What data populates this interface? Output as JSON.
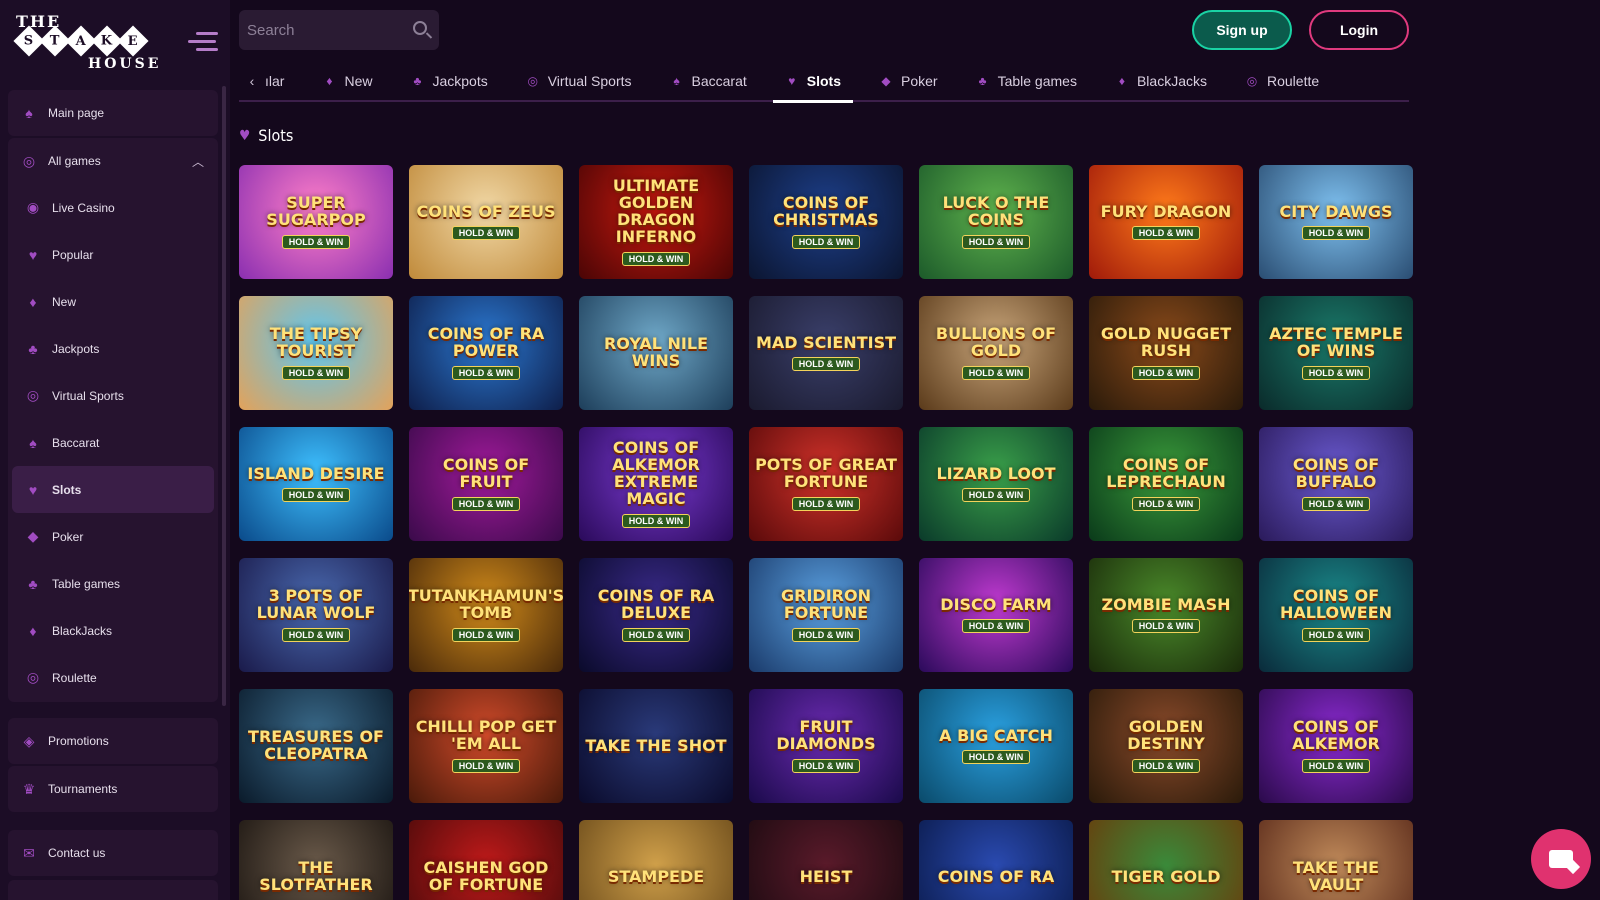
{
  "logo": {
    "row1": "THE",
    "letters": [
      "S",
      "T",
      "A",
      "K",
      "E"
    ],
    "row3": "HOUSE"
  },
  "header": {
    "search_placeholder": "Search",
    "signup_label": "Sign up",
    "login_label": "Login"
  },
  "sidebar": {
    "main_page": "Main page",
    "all_games": "All games",
    "items": [
      {
        "label": "Live Casino",
        "icon": "live-casino-icon"
      },
      {
        "label": "Popular",
        "icon": "popular-icon"
      },
      {
        "label": "New",
        "icon": "new-icon"
      },
      {
        "label": "Jackpots",
        "icon": "jackpots-icon"
      },
      {
        "label": "Virtual Sports",
        "icon": "virtual-sports-icon"
      },
      {
        "label": "Baccarat",
        "icon": "baccarat-icon"
      },
      {
        "label": "Slots",
        "icon": "slots-icon"
      },
      {
        "label": "Poker",
        "icon": "poker-icon"
      },
      {
        "label": "Table games",
        "icon": "table-games-icon"
      },
      {
        "label": "BlackJacks",
        "icon": "blackjacks-icon"
      },
      {
        "label": "Roulette",
        "icon": "roulette-icon"
      }
    ],
    "promotions": "Promotions",
    "tournaments": "Tournaments",
    "contact_us": "Contact us"
  },
  "tabs": [
    "ılar",
    "New",
    "Jackpots",
    "Virtual Sports",
    "Baccarat",
    "Slots",
    "Poker",
    "Table games",
    "BlackJacks",
    "Roulette"
  ],
  "active_tab": "Slots",
  "section_title": "Slots",
  "games": [
    {
      "name": "Super SugarPop",
      "badge": "HOLD & WIN",
      "colors": [
        "#ff7fc8",
        "#8a2fb0"
      ]
    },
    {
      "name": "Coins of Zeus",
      "badge": "HOLD & WIN",
      "colors": [
        "#f1d8a6",
        "#c08a3a"
      ]
    },
    {
      "name": "Ultimate Golden Dragon Inferno",
      "badge": "HOLD & WIN",
      "colors": [
        "#c8190f",
        "#4a0505"
      ]
    },
    {
      "name": "Coins of Christmas",
      "badge": "HOLD & WIN",
      "colors": [
        "#1d3f8a",
        "#0b1530"
      ]
    },
    {
      "name": "Luck o the Coins",
      "badge": "HOLD & WIN",
      "colors": [
        "#5fb34d",
        "#1c5a2a"
      ]
    },
    {
      "name": "Fury Dragon",
      "badge": "HOLD & WIN",
      "colors": [
        "#ff7a1a",
        "#a01a0a"
      ]
    },
    {
      "name": "City Dawgs",
      "badge": "HOLD & WIN",
      "colors": [
        "#7ec0ef",
        "#2a4d72"
      ]
    },
    {
      "name": "The Tipsy Tourist",
      "badge": "HOLD & WIN",
      "colors": [
        "#5ec6ef",
        "#e3a25a"
      ]
    },
    {
      "name": "Coins of Ra Power",
      "badge": "HOLD & WIN",
      "colors": [
        "#2b78d0",
        "#0e1e4a"
      ]
    },
    {
      "name": "Royal Nile Wins",
      "badge": "",
      "colors": [
        "#6fa8c8",
        "#1d3e5a"
      ]
    },
    {
      "name": "Mad Scientist",
      "badge": "HOLD & WIN",
      "colors": [
        "#3a3f6a",
        "#1a1a2e"
      ]
    },
    {
      "name": "Bullions of Gold",
      "badge": "HOLD & WIN",
      "colors": [
        "#c8a57a",
        "#5a3a1a"
      ]
    },
    {
      "name": "Gold Nugget Rush",
      "badge": "HOLD & WIN",
      "colors": [
        "#8a4a1a",
        "#2a1a0a"
      ]
    },
    {
      "name": "Aztec Temple of Wins",
      "badge": "HOLD & WIN",
      "colors": [
        "#1a7a6a",
        "#0a2a2a"
      ]
    },
    {
      "name": "Island Desire",
      "badge": "HOLD & WIN",
      "colors": [
        "#3ec0ff",
        "#0a4a8a"
      ]
    },
    {
      "name": "Coins of Fruit",
      "badge": "HOLD & WIN",
      "colors": [
        "#a01a9a",
        "#3a0a4a"
      ]
    },
    {
      "name": "Coins of Alkemor Extreme Magic",
      "badge": "HOLD & WIN",
      "colors": [
        "#7a3ad0",
        "#2a0a5a"
      ]
    },
    {
      "name": "Pots of Great Fortune",
      "badge": "HOLD & WIN",
      "colors": [
        "#d0322a",
        "#5a0a0a"
      ]
    },
    {
      "name": "Lizard Loot",
      "badge": "HOLD & WIN",
      "colors": [
        "#3aa04a",
        "#0a3a2a"
      ]
    },
    {
      "name": "Coins of Leprechaun",
      "badge": "HOLD & WIN",
      "colors": [
        "#3a9a3a",
        "#0a3a1a"
      ]
    },
    {
      "name": "Coins of Buffalo",
      "badge": "HOLD & WIN",
      "colors": [
        "#6a5ad0",
        "#2a1a5a"
      ]
    },
    {
      "name": "3 Pots of Lunar Wolf",
      "badge": "HOLD & WIN",
      "colors": [
        "#4a6ab0",
        "#1a1a4a"
      ]
    },
    {
      "name": "Tutankhamun's Tomb",
      "badge": "HOLD & WIN",
      "colors": [
        "#d08a1a",
        "#4a2a0a"
      ]
    },
    {
      "name": "Coins of Ra Deluxe",
      "badge": "HOLD & WIN",
      "colors": [
        "#3a2a8a",
        "#0a0a2a"
      ]
    },
    {
      "name": "Gridiron Fortune",
      "badge": "HOLD & WIN",
      "colors": [
        "#5aa0e0",
        "#1a3a6a"
      ]
    },
    {
      "name": "Disco Farm",
      "badge": "HOLD & WIN",
      "colors": [
        "#c03ad0",
        "#2a0a5a"
      ]
    },
    {
      "name": "Zombie Mash",
      "badge": "HOLD & WIN",
      "colors": [
        "#4a8a2a",
        "#1a2a0a"
      ]
    },
    {
      "name": "Coins of Halloween",
      "badge": "HOLD & WIN",
      "colors": [
        "#1a8a8a",
        "#0a2a3a"
      ]
    },
    {
      "name": "Treasures of Cleopatra",
      "badge": "",
      "colors": [
        "#3a6a8a",
        "#0a1a2a"
      ]
    },
    {
      "name": "Chilli Pop Get 'Em All",
      "badge": "HOLD & WIN",
      "colors": [
        "#d04a2a",
        "#4a1a0a"
      ]
    },
    {
      "name": "Take the Shot",
      "badge": "",
      "colors": [
        "#2a3a7a",
        "#0a0a2a"
      ]
    },
    {
      "name": "Fruit Diamonds",
      "badge": "HOLD & WIN",
      "colors": [
        "#6a2ab0",
        "#1a0a4a"
      ]
    },
    {
      "name": "A Big Catch",
      "badge": "HOLD & WIN",
      "colors": [
        "#2aa0e0",
        "#0a4a6a"
      ]
    },
    {
      "name": "Golden Destiny",
      "badge": "HOLD & WIN",
      "colors": [
        "#8a4a2a",
        "#2a1a0a"
      ]
    },
    {
      "name": "Coins of Alkemor",
      "badge": "HOLD & WIN",
      "colors": [
        "#8a2ad0",
        "#2a0a4a"
      ]
    },
    {
      "name": "The Slotfather",
      "badge": "",
      "colors": [
        "#6a5a4a",
        "#1a1410"
      ]
    },
    {
      "name": "Caishen God of Fortune",
      "badge": "",
      "colors": [
        "#c01a1a",
        "#4a0a0a"
      ]
    },
    {
      "name": "Stampede",
      "badge": "",
      "colors": [
        "#d0a04a",
        "#6a4a1a"
      ]
    },
    {
      "name": "Heist",
      "badge": "",
      "colors": [
        "#5a1a2a",
        "#1a0a10"
      ]
    },
    {
      "name": "Coins of Ra",
      "badge": "",
      "colors": [
        "#2a4ab0",
        "#0a1a4a"
      ]
    },
    {
      "name": "Tiger Gold",
      "badge": "",
      "colors": [
        "#3a8a3a",
        "#6a3a0a"
      ]
    },
    {
      "name": "Take the Vault",
      "badge": "",
      "colors": [
        "#c08a5a",
        "#5a2a1a"
      ]
    }
  ]
}
